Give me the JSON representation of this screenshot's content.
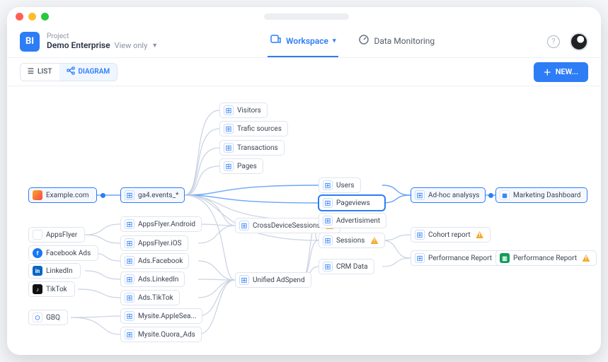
{
  "project": {
    "label": "Project",
    "name": "Demo Enterprise",
    "mode": "View only"
  },
  "header_tabs": {
    "workspace": "Workspace",
    "monitoring": "Data Monitoring"
  },
  "toolbar": {
    "list": "LIST",
    "diagram": "DIAGRAM",
    "new": "NEW..."
  },
  "logo_text": "BI",
  "sources": {
    "example": "Example.com",
    "appsflyer": "AppsFlyer",
    "facebook": "Facebook Ads",
    "linkedin": "LinkedIn",
    "tiktok": "TikTok",
    "gbq": "GBQ"
  },
  "col2": {
    "ga4": "ga4.events_*",
    "af_android": "AppsFlyer.Android",
    "af_ios": "AppsFlyer.iOS",
    "ads_facebook": "Ads.Facebook",
    "ads_linkedin": "Ads.LinkedIn",
    "ads_tiktok": "Ads.TikTok",
    "mysite_apple": "Mysite.AppleSea...",
    "mysite_quora": "Mysite.Quora_Ads"
  },
  "col3": {
    "visitors": "Visitors",
    "traffic": "Trafic sources",
    "transactions": "Transactions",
    "pages": "Pages",
    "cross_device": "CrossDeviceSessions",
    "unified": "Unified AdSpend"
  },
  "col4": {
    "users": "Users",
    "pageviews": "Pageviews",
    "advertisiment": "Advertisiment",
    "sessions": "Sessions",
    "crm": "CRM Data"
  },
  "col5": {
    "adhoc": "Ad-hoc analysys",
    "cohort": "Cohort report",
    "perf": "Performance Report"
  },
  "col6": {
    "marketing": "Marketing Dashboard",
    "perf2": "Performance Report"
  }
}
